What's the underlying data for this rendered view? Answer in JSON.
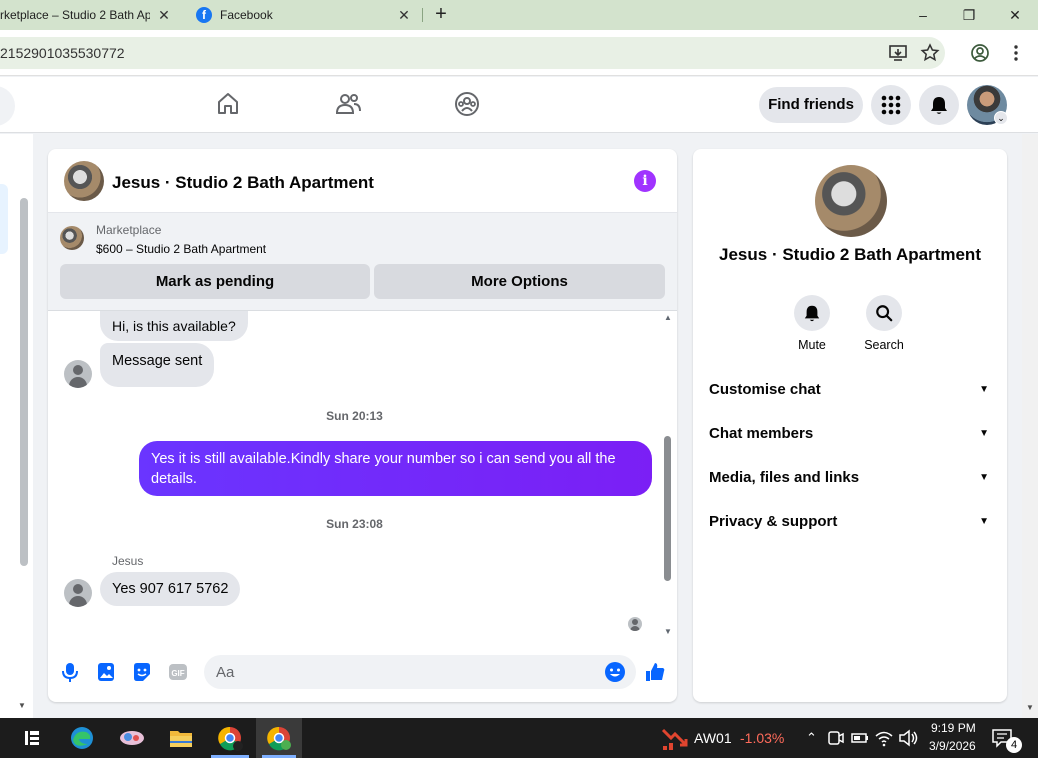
{
  "browser": {
    "tabs": [
      {
        "title": "rketplace – Studio 2 Bath Ap",
        "close": "✕"
      },
      {
        "title": "Facebook",
        "close": "✕"
      }
    ],
    "new_tab": "+",
    "window_controls": {
      "minimize": "–",
      "restore": "❐",
      "close": "✕"
    },
    "url": "2152901035530772"
  },
  "fbnav": {
    "find_friends": "Find friends"
  },
  "chat": {
    "title": "Jesus · Studio 2 Bath Apartment",
    "info_icon": "i",
    "listing": {
      "category": "Marketplace",
      "description": "$600 – Studio 2 Bath Apartment",
      "buttons": {
        "pending": "Mark as pending",
        "more": "More Options"
      }
    },
    "messages": [
      {
        "from": "other",
        "text": "Hi, is this available?"
      },
      {
        "from": "other",
        "text": "Message sent"
      },
      {
        "type": "timestamp",
        "text": "Sun 20:13"
      },
      {
        "from": "me",
        "text": "Yes it is still available.Kindly share your number so i can send you all the details."
      },
      {
        "type": "timestamp",
        "text": "Sun 23:08"
      },
      {
        "from": "other",
        "sender": "Jesus",
        "text": "Yes 907 617 5762"
      }
    ],
    "composer": {
      "placeholder": "Aa",
      "gif_label": "GIF"
    }
  },
  "details": {
    "title": "Jesus · Studio 2 Bath Apartment",
    "actions": [
      {
        "label": "Mute",
        "icon": "bell-icon"
      },
      {
        "label": "Search",
        "icon": "search-icon"
      }
    ],
    "sections": [
      "Customise chat",
      "Chat members",
      "Media, files and links",
      "Privacy & support"
    ]
  },
  "taskbar": {
    "stock": {
      "name": "AW01",
      "change": "-1.03%"
    },
    "clock": {
      "time": "9:19 PM",
      "date": "3/9/2026"
    },
    "notifications": "4"
  },
  "colors": {
    "accent_purple": "#7b2ff7",
    "fb_blue": "#0866ff",
    "stock_down": "#ff6b5b"
  }
}
